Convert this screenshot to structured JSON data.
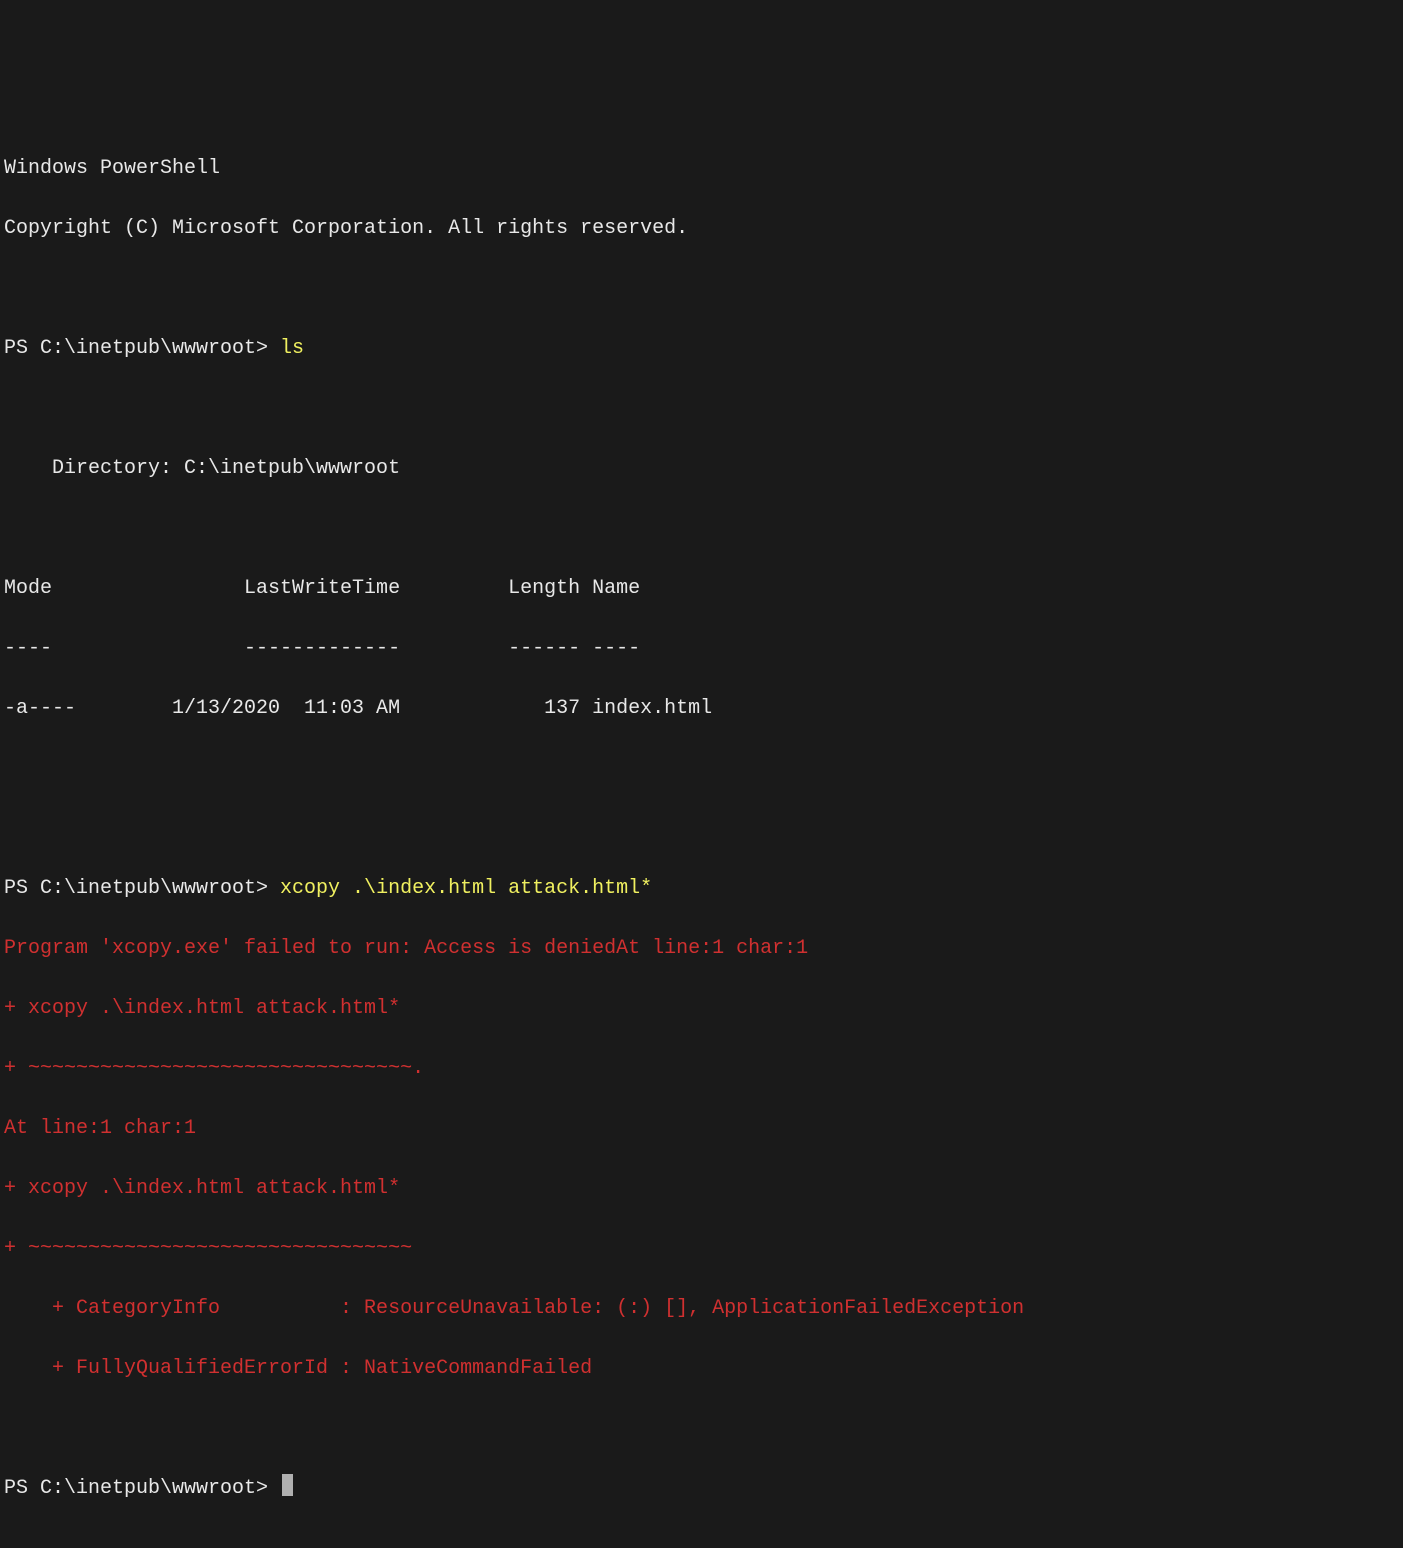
{
  "header": {
    "title": "Windows PowerShell",
    "copyright": "Copyright (C) Microsoft Corporation. All rights reserved."
  },
  "prompt1": {
    "path": "PS C:\\inetpub\\wwwroot> ",
    "command": "ls"
  },
  "ls_output": {
    "blank1": "",
    "blank2": "",
    "directory_line": "    Directory: C:\\inetpub\\wwwroot",
    "blank3": "",
    "blank4": "",
    "header_row": "Mode                LastWriteTime         Length Name",
    "divider_row": "----                -------------         ------ ----",
    "row1": "-a----        1/13/2020  11:03 AM            137 index.html"
  },
  "prompt2": {
    "path": "PS C:\\inetpub\\wwwroot> ",
    "command": "xcopy .\\index.html attack.html*"
  },
  "error": {
    "l1": "Program 'xcopy.exe' failed to run: Access is deniedAt line:1 char:1",
    "l2": "+ xcopy .\\index.html attack.html*",
    "l3": "+ ~~~~~~~~~~~~~~~~~~~~~~~~~~~~~~~~.",
    "l4": "At line:1 char:1",
    "l5": "+ xcopy .\\index.html attack.html*",
    "l6": "+ ~~~~~~~~~~~~~~~~~~~~~~~~~~~~~~~~",
    "l7": "    + CategoryInfo          : ResourceUnavailable: (:) [], ApplicationFailedException",
    "l8": "    + FullyQualifiedErrorId : NativeCommandFailed"
  },
  "prompt3": {
    "path": "PS C:\\inetpub\\wwwroot> "
  }
}
